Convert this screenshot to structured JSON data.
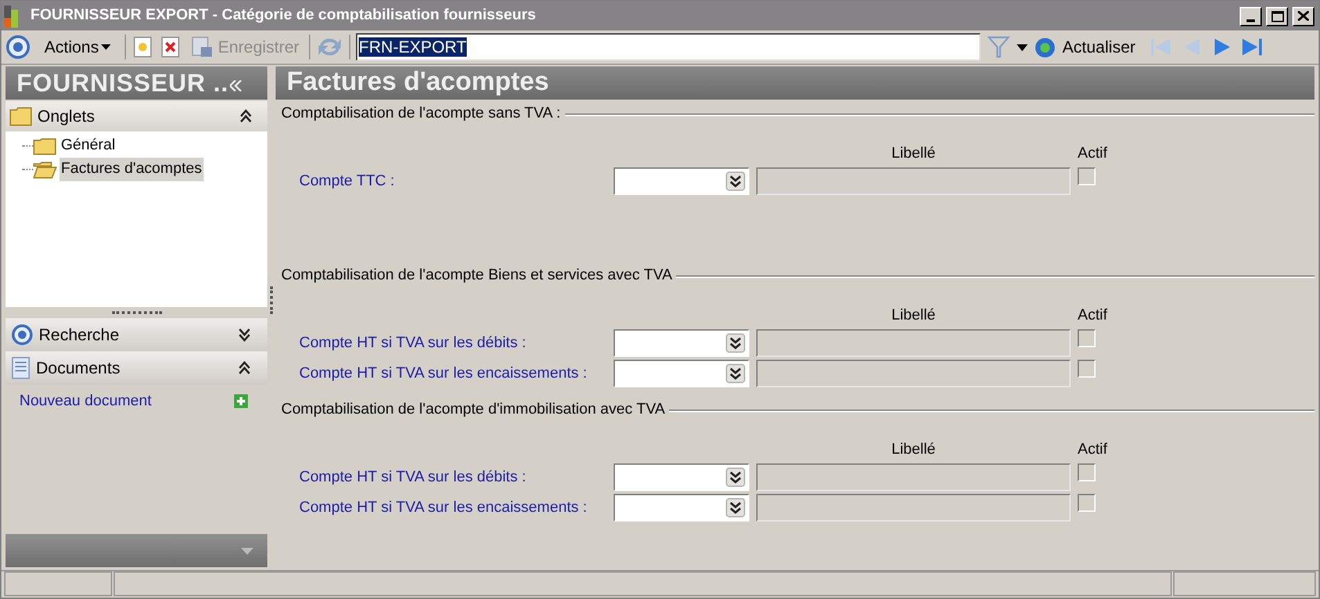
{
  "window": {
    "title": "FOURNISSEUR EXPORT - Catégorie de comptabilisation fournisseurs"
  },
  "toolbar": {
    "actions": "Actions",
    "save": {
      "label": "Enregistrer",
      "disabled": true
    },
    "record": "FRN-EXPORT",
    "refresh": "Actualiser",
    "nav": [
      {
        "kind": "first",
        "disabled": true
      },
      {
        "kind": "prev",
        "disabled": true
      },
      {
        "kind": "next",
        "disabled": false
      },
      {
        "kind": "last",
        "disabled": false
      }
    ]
  },
  "sidebar": {
    "title": "FOURNISSEUR ..",
    "onglets": {
      "label": "Onglets",
      "expanded": true,
      "items": [
        {
          "label": "Général",
          "selected": false
        },
        {
          "label": "Factures d'acomptes",
          "selected": true
        }
      ]
    },
    "recherche": {
      "label": "Recherche",
      "expanded": false
    },
    "documents": {
      "label": "Documents",
      "expanded": true,
      "links": [
        "Nouveau document"
      ]
    }
  },
  "content": {
    "title": "Factures d'acomptes",
    "sections": [
      {
        "title": "Comptabilisation de l'acompte sans TVA :",
        "libelle_header": "Libellé",
        "actif_header": "Actif",
        "rows": [
          {
            "label": "Compte TTC  :",
            "checked": false
          }
        ]
      },
      {
        "title": "Comptabilisation de l'acompte Biens et services avec TVA",
        "libelle_header": "Libellé",
        "actif_header": "Actif",
        "rows": [
          {
            "label": "Compte HT si TVA sur les débits :",
            "checked": false
          },
          {
            "label": "Compte HT si TVA sur les encaissements :",
            "checked": false
          }
        ]
      },
      {
        "title": "Comptabilisation de l'acompte d'immobilisation avec TVA",
        "libelle_header": "Libellé",
        "actif_header": "Actif",
        "rows": [
          {
            "label": "Compte HT si TVA sur les débits :",
            "checked": false
          },
          {
            "label": "Compte HT si TVA sur les encaissements :",
            "checked": false
          }
        ]
      }
    ]
  }
}
